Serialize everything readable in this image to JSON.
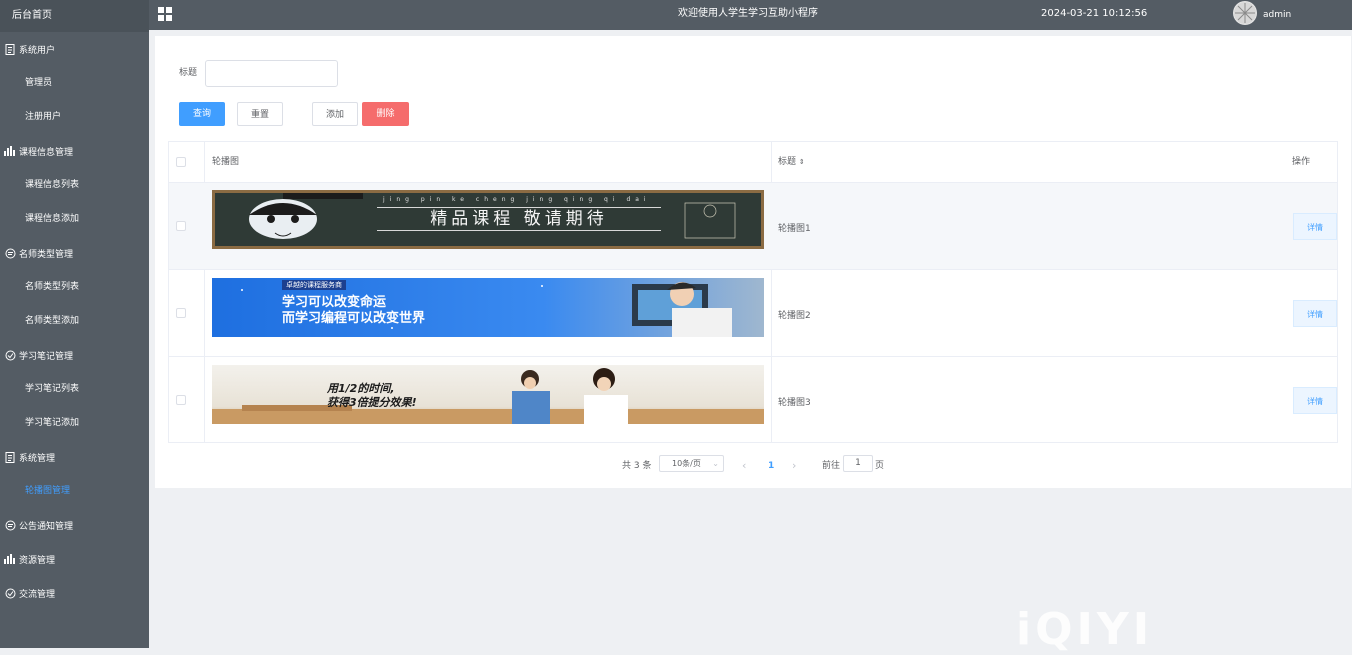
{
  "sidebar": {
    "home": "后台首页",
    "groups": [
      {
        "label": "系统用户",
        "icon": "document-icon",
        "items": [
          "管理员",
          "注册用户"
        ]
      },
      {
        "label": "课程信息管理",
        "icon": "bar-chart-icon",
        "items": [
          "课程信息列表",
          "课程信息添加"
        ]
      },
      {
        "label": "名师类型管理",
        "icon": "chat-icon",
        "items": [
          "名师类型列表",
          "名师类型添加"
        ]
      },
      {
        "label": "学习笔记管理",
        "icon": "check-circle-icon",
        "items": [
          "学习笔记列表",
          "学习笔记添加"
        ]
      },
      {
        "label": "系统管理",
        "icon": "document-icon",
        "items": [
          "轮播图管理"
        ]
      },
      {
        "label": "公告通知管理",
        "icon": "chat-icon",
        "items": []
      },
      {
        "label": "资源管理",
        "icon": "bar-chart-icon",
        "items": []
      },
      {
        "label": "交流管理",
        "icon": "check-circle-icon",
        "items": []
      }
    ],
    "active_item": "轮播图管理"
  },
  "header": {
    "title": "欢迎使用人学生学习互助小程序",
    "datetime": "2024-03-21 10:12:56",
    "user": "admin"
  },
  "search": {
    "label": "标题",
    "value": "",
    "buttons": {
      "query": "查询",
      "reset": "重置",
      "add": "添加",
      "delete": "删除"
    }
  },
  "table": {
    "columns": [
      "轮播图",
      "标题",
      "操作"
    ],
    "rows": [
      {
        "title": "轮播图1",
        "action": "详情",
        "banner_text": "精品课程 敬请期待",
        "banner_pinyin": "jing pin ke cheng jing qing qi dai"
      },
      {
        "title": "轮播图2",
        "action": "详情",
        "banner_text": "学习可以改变命运",
        "banner_text2": "而学习编程可以改变世界",
        "banner_tag": "卓越的课程服务商"
      },
      {
        "title": "轮播图3",
        "action": "详情",
        "banner_text": "用1/2的时间,",
        "banner_text2": "获得3倍提分效果!"
      }
    ]
  },
  "pagination": {
    "total": "共 3 条",
    "page_size": "10条/页",
    "current_page": "1",
    "goto_label": "前往",
    "goto_value": "1",
    "page_unit": "页",
    "prev": "‹",
    "next": "›"
  },
  "watermark": "iQIYI",
  "colors": {
    "sidebar": "#545c64",
    "primary": "#409eff",
    "danger": "#f56c6c"
  }
}
